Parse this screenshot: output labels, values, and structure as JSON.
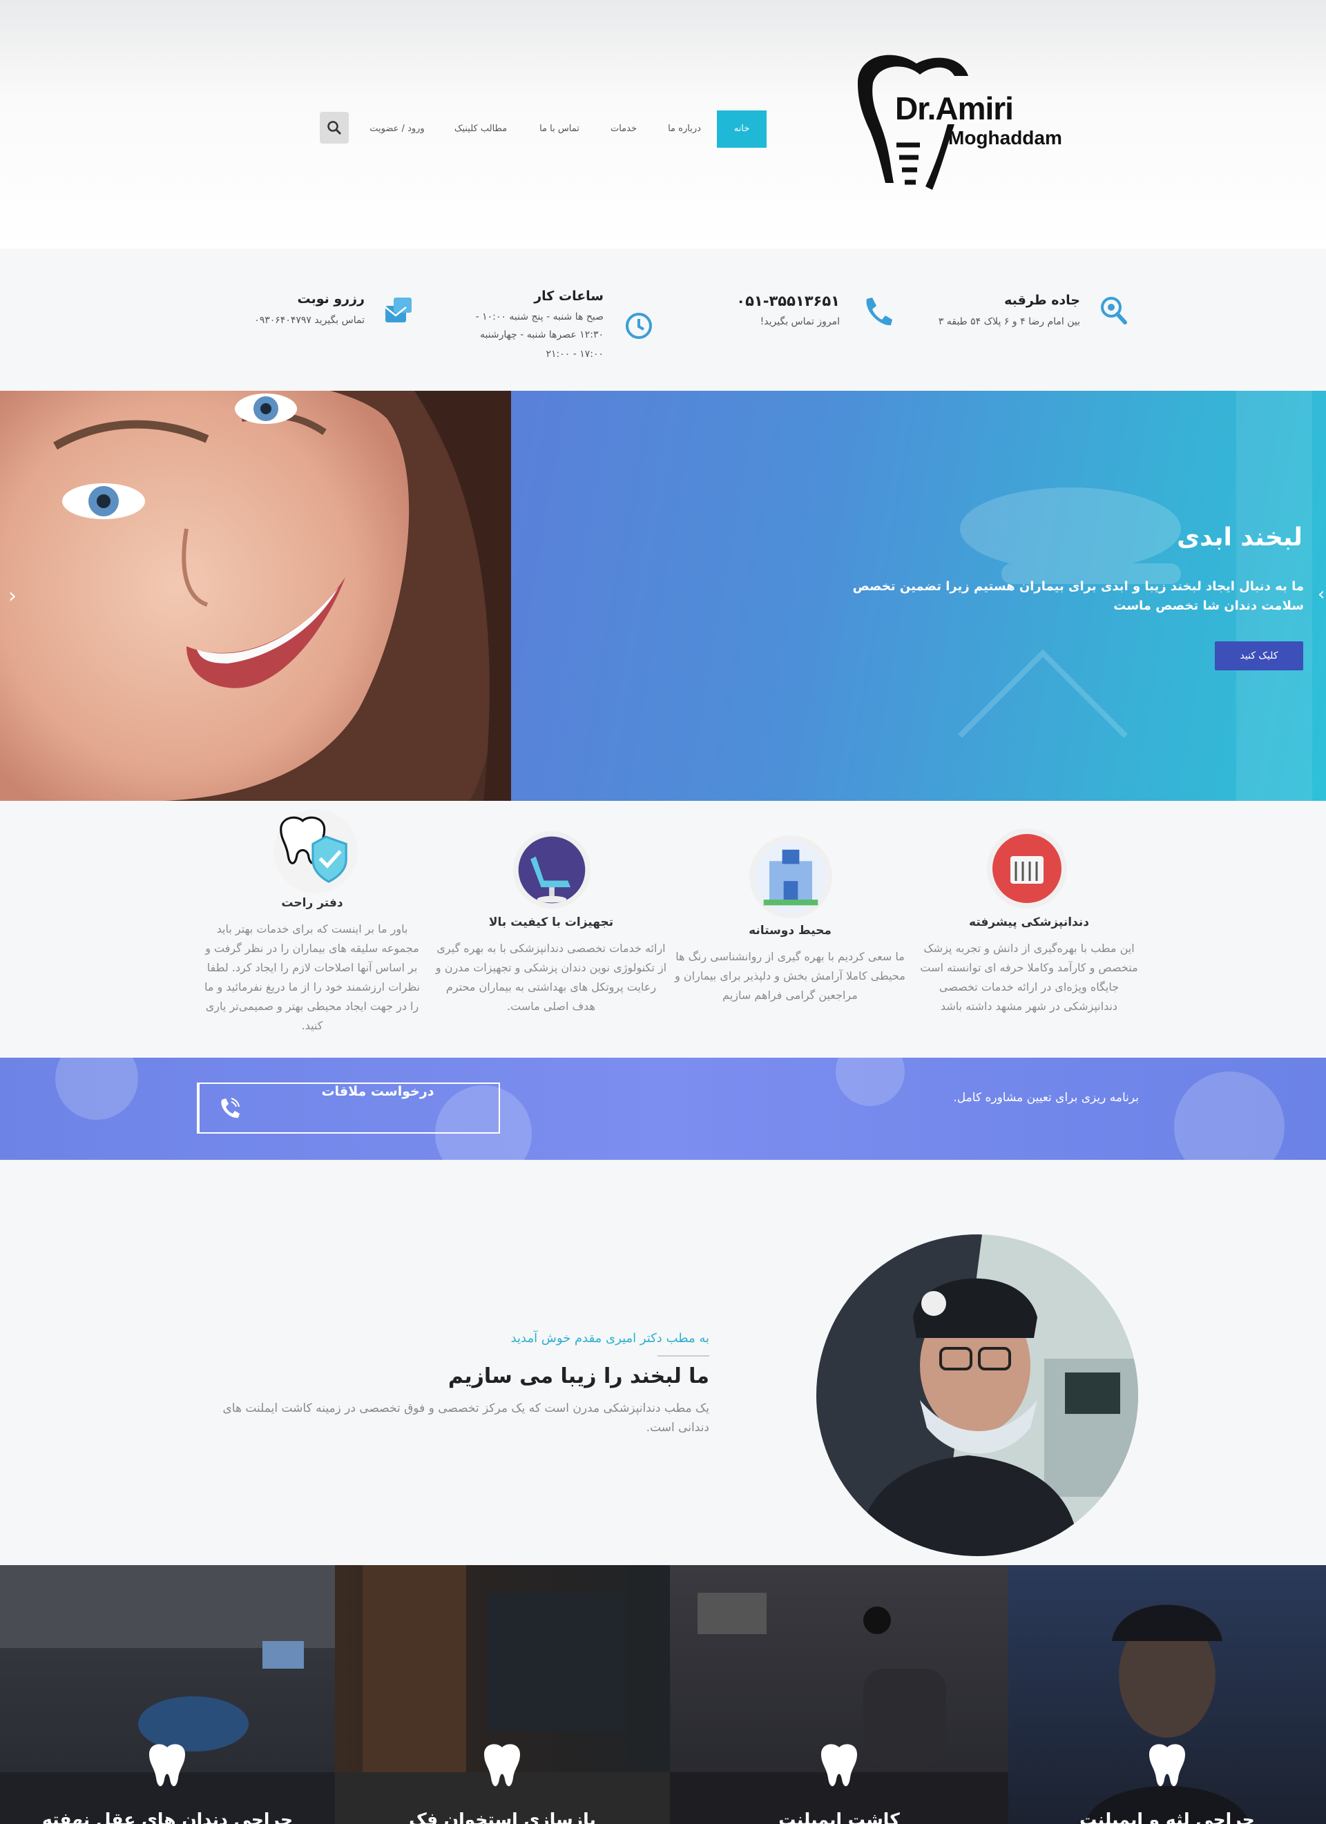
{
  "brand": {
    "line1": "Dr.Amiri",
    "line2": "Moghaddam"
  },
  "nav": {
    "items": [
      "خانه",
      "درباره ما",
      "خدمات",
      "تماس با ما",
      "مطالب کلینیک",
      "ورود / عضویت"
    ],
    "active": "خانه"
  },
  "info": {
    "address": {
      "title": "جاده طرقبه",
      "sub": "بین امام رضا ۴ و ۶ پلاک ۵۴ طبقه ۳"
    },
    "phone": {
      "title": "۰۵۱-۳۵۵۱۳۶۵۱",
      "sub": "امروز تماس بگیرید!"
    },
    "hours": {
      "title": "ساعات کار",
      "line1": "صبح ها شنبه - پنج شنبه ۱۰:۰۰ -",
      "line2": "۱۲:۳۰ عصرها شنبه - چهارشنبه",
      "line3": "۱۷:۰۰ - ۲۱:۰۰"
    },
    "booking": {
      "title": "رزرو نوبت",
      "sub": "تماس بگیرید ۰۹۳۰۶۴۰۴۷۹۷"
    }
  },
  "hero": {
    "title": "لبخند ابدی",
    "text": "ما به دنبال ایجاد لبخند زیبا و ابدی برای بیماران هستیم زیرا تضمین تخصص سلامت دندان شا تخصص ماست",
    "button": "کلیک کنید"
  },
  "features": [
    {
      "title": "دندانپزشکی پیشرفته",
      "text": "این مطب با بهره‌گیری از دانش و تجربه پزشک متخصص و کارآمد وکاملا حرفه ای توانسته است جایگاه ویژه‌ای در ارائه خدمات تخصصی دندانپزشکی در شهر مشهد داشته باشد"
    },
    {
      "title": "محیط دوستانه",
      "text": "ما سعی کردیم با بهره گیری از روانشناسی رنگ ها محیطی کاملا آرامش بخش و دلپذیر برای بیماران و مراجعین گرامی فراهم سازیم"
    },
    {
      "title": "تجهیزات با کیفیت بالا",
      "text": "ارائه خدمات تخصصی دندانپزشکی با به بهره گیری از تکنولوژی نوین دندان پزشکی و تجهیزات مدرن و رعایت پروتکل های بهداشتی به بیماران محترم هدف اصلی ماست."
    },
    {
      "title": "دفتر راحت",
      "text": "باور ما بر اینست که برای خدمات بهتر باید مجموعه سلیقه های بیماران را در نظر گرفت و بر اساس آنها اصلاحات لازم را ایجاد کرد. لطفا نظرات ارزشمند خود را از ما دریغ نفرمائید و ما را در جهت ایجاد محیطی بهتر و صمیمی‌تر یاری کنید."
    }
  ],
  "cta": {
    "text": "برنامه ریزی برای تعیین مشاوره کامل.",
    "button": "درخواست ملاقات"
  },
  "welcome": {
    "sub": "به مطب دکتر امیری مقدم خوش آمدید",
    "title": "ما لبخند را زیبا می سازیم",
    "text": "یک مطب دندانپزشکی مدرن است که یک مرکز تخصصی و فوق تخصصی در زمینه کاشت ایملنت های دندانی است."
  },
  "services": [
    "جراحی لثه و ایمپلنت",
    "کاشت ایمپلنت",
    "بازسازی استخوان فک",
    "جراحی دندان های عقل نهفته"
  ],
  "colors": {
    "accent": "#1fb8d6",
    "hero_button": "#3d4fb8",
    "cta_band": "#7488ec"
  }
}
